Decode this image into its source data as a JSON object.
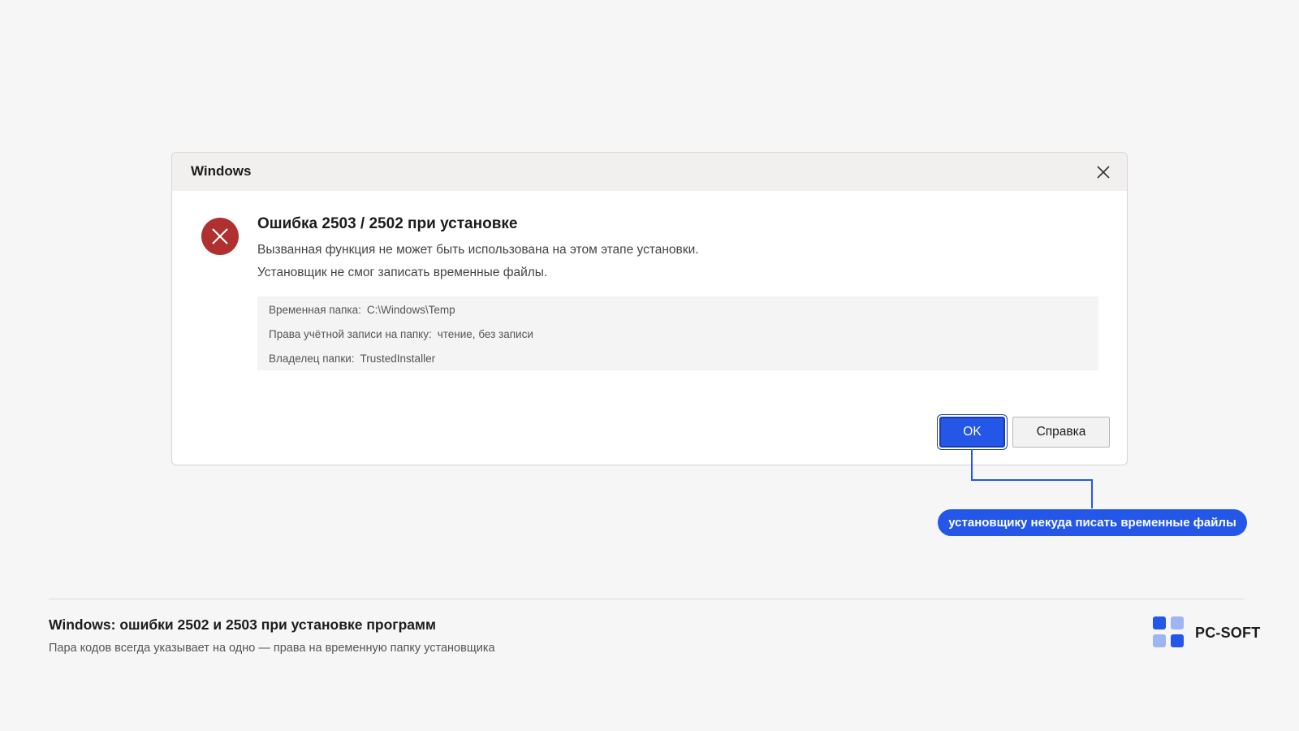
{
  "dialog": {
    "title": "Windows",
    "icon": "error-icon",
    "heading": "Ошибка 2503 / 2502 при установке",
    "message_line1": "Вызванная функция не может быть использована на этом этапе установки.",
    "message_line2": "Установщик не смог записать временные файлы.",
    "details": [
      {
        "label": "Временная папка:",
        "value": "C:\\Windows\\Temp"
      },
      {
        "label": "Права учётной записи на папку:",
        "value": "чтение, без записи"
      },
      {
        "label": "Владелец папки:",
        "value": "TrustedInstaller"
      }
    ],
    "ok_label": "OK",
    "help_label": "Справка"
  },
  "callout": {
    "text": "установщику некуда писать временные файлы"
  },
  "footer": {
    "title": "Windows: ошибки 2502 и 2503 при установке программ",
    "subtitle": "Пара кодов всегда указывает на одно — права на временную папку установщика"
  },
  "brand": {
    "name": "PC-SOFT"
  },
  "colors": {
    "accent": "#2457e8",
    "error_red": "#b03030",
    "background": "#f6f6f6"
  }
}
